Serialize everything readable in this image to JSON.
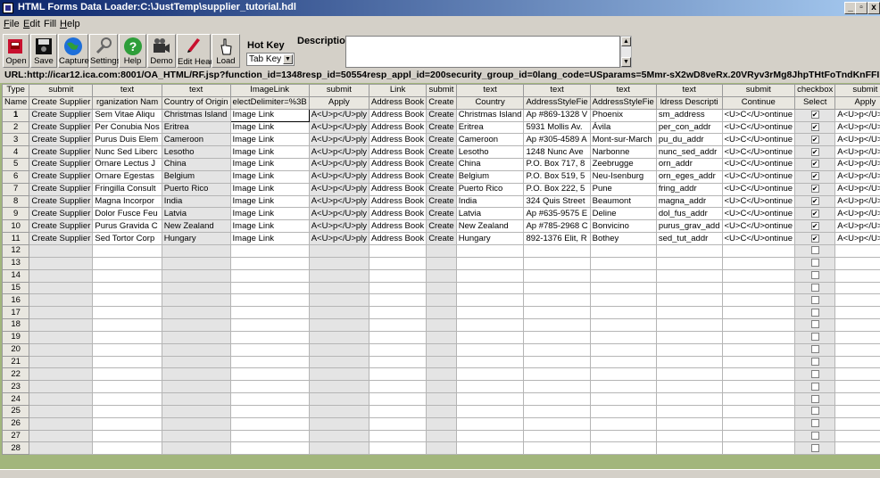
{
  "window": {
    "title": "HTML Forms Data Loader:C:\\JustTemp\\supplier_tutorial.hdl",
    "minimize": "_",
    "restore": "▫",
    "close": "x"
  },
  "menu": [
    {
      "label": "File",
      "ul": "F",
      "rest": "ile"
    },
    {
      "label": "Edit",
      "ul": "E",
      "rest": "dit"
    },
    {
      "label": "Fill",
      "ul": "",
      "rest": "Fill"
    },
    {
      "label": "Help",
      "ul": "H",
      "rest": "elp"
    }
  ],
  "toolbar": {
    "open": "Open",
    "save": "Save",
    "capture": "Capture",
    "settings": "Settings",
    "help": "Help",
    "demo": "Demo",
    "edit_headings": "Edit Headings",
    "load": "Load",
    "help_glyph": "?"
  },
  "hotkey": {
    "label": "Hot Key",
    "value": "Tab Key",
    "arrow": "▼"
  },
  "description": {
    "label": "Description",
    "value": "",
    "up": "▲",
    "down": "▼"
  },
  "url": "URL:http://icar12.ica.com:8001/OA_HTML/RF.jsp?function_id=1348resp_id=50554resp_appl_id=200security_group_id=0lang_code=USparams=5Mmr-sX2wD8veRx.20VRyv3rMg8JhpTHtFoTndKnFFI",
  "grid": {
    "type_row": [
      "Type",
      "submit",
      "text",
      "text",
      "ImageLink",
      "submit",
      "Link",
      "submit",
      "text",
      "text",
      "text",
      "text",
      "submit",
      "checkbox",
      "submit"
    ],
    "name_row": [
      "Name",
      "Create Supplier",
      "rganization Nam",
      "Country of Origin",
      "electDelimiter=%3B",
      "Apply",
      "Address Book",
      "Create",
      "Country",
      "AddressStyleFie",
      "AddressStyleFie",
      "ldress Descripti",
      "Continue",
      "Select",
      "Apply"
    ],
    "rows": [
      [
        "Create Supplier",
        "Sem Vitae Aliqu",
        "Christmas Island",
        "Image Link",
        "A<U>p</U>ply",
        "Address Book",
        "Create",
        "Christmas Island",
        "Ap #869-1328 V",
        "Phoenix",
        "sm_address",
        "<U>C</U>ontinue",
        "checked",
        "A<U>p</U>ply"
      ],
      [
        "Create Supplier",
        "Per Conubia Nos",
        "Eritrea",
        "Image Link",
        "A<U>p</U>ply",
        "Address Book",
        "Create",
        "Eritrea",
        "5931 Mollis Av.",
        "Ávila",
        "per_con_addr",
        "<U>C</U>ontinue",
        "checked",
        "A<U>p</U>ply"
      ],
      [
        "Create Supplier",
        "Purus Duis Elem",
        "Cameroon",
        "Image Link",
        "A<U>p</U>ply",
        "Address Book",
        "Create",
        "Cameroon",
        "Ap #305-4589 A",
        "Mont-sur-March",
        "pu_du_addr",
        "<U>C</U>ontinue",
        "checked",
        "A<U>p</U>ply"
      ],
      [
        "Create Supplier",
        "Nunc Sed Liberc",
        "Lesotho",
        "Image Link",
        "A<U>p</U>ply",
        "Address Book",
        "Create",
        "Lesotho",
        "1248 Nunc Ave",
        "Narbonne",
        "nunc_sed_addr",
        "<U>C</U>ontinue",
        "checked",
        "A<U>p</U>ply"
      ],
      [
        "Create Supplier",
        "Ornare Lectus J",
        "China",
        "Image Link",
        "A<U>p</U>ply",
        "Address Book",
        "Create",
        "China",
        "P.O. Box 717, 8",
        "Zeebrugge",
        "orn_addr",
        "<U>C</U>ontinue",
        "checked",
        "A<U>p</U>ply"
      ],
      [
        "Create Supplier",
        "Ornare Egestas",
        "Belgium",
        "Image Link",
        "A<U>p</U>ply",
        "Address Book",
        "Create",
        "Belgium",
        "P.O. Box 519, 5",
        "Neu-Isenburg",
        "orn_eges_addr",
        "<U>C</U>ontinue",
        "checked",
        "A<U>p</U>ply"
      ],
      [
        "Create Supplier",
        "Fringilla Consult",
        "Puerto Rico",
        "Image Link",
        "A<U>p</U>ply",
        "Address Book",
        "Create",
        "Puerto Rico",
        "P.O. Box 222, 5",
        "Pune",
        "fring_addr",
        "<U>C</U>ontinue",
        "checked",
        "A<U>p</U>ply"
      ],
      [
        "Create Supplier",
        "Magna Incorpor",
        "India",
        "Image Link",
        "A<U>p</U>ply",
        "Address Book",
        "Create",
        "India",
        "324 Quis Street",
        "Beaumont",
        "magna_addr",
        "<U>C</U>ontinue",
        "checked",
        "A<U>p</U>ply"
      ],
      [
        "Create Supplier",
        "Dolor Fusce Feu",
        "Latvia",
        "Image Link",
        "A<U>p</U>ply",
        "Address Book",
        "Create",
        "Latvia",
        "Ap #635-9575 E",
        "Deline",
        "dol_fus_addr",
        "<U>C</U>ontinue",
        "checked",
        "A<U>p</U>ply"
      ],
      [
        "Create Supplier",
        "Purus Gravida C",
        "New Zealand",
        "Image Link",
        "A<U>p</U>ply",
        "Address Book",
        "Create",
        "New Zealand",
        "Ap #785-2968 C",
        "Bonvicino",
        "purus_grav_add",
        "<U>C</U>ontinue",
        "checked",
        "A<U>p</U>ply"
      ],
      [
        "Create Supplier",
        "Sed Tortor Corp",
        "Hungary",
        "Image Link",
        "A<U>p</U>ply",
        "Address Book",
        "Create",
        "Hungary",
        "892-1376 Elit, R",
        "Bothey",
        "sed_tut_addr",
        "<U>C</U>ontinue",
        "checked",
        "A<U>p</U>ply"
      ]
    ],
    "row_numbers": [
      "1",
      "2",
      "3",
      "4",
      "5",
      "6",
      "7",
      "8",
      "9",
      "10",
      "11",
      "12",
      "13",
      "14",
      "15",
      "16",
      "17",
      "18",
      "19",
      "20",
      "21",
      "22",
      "23",
      "24",
      "25",
      "26",
      "27",
      "28"
    ],
    "check_glyph": "✔"
  }
}
